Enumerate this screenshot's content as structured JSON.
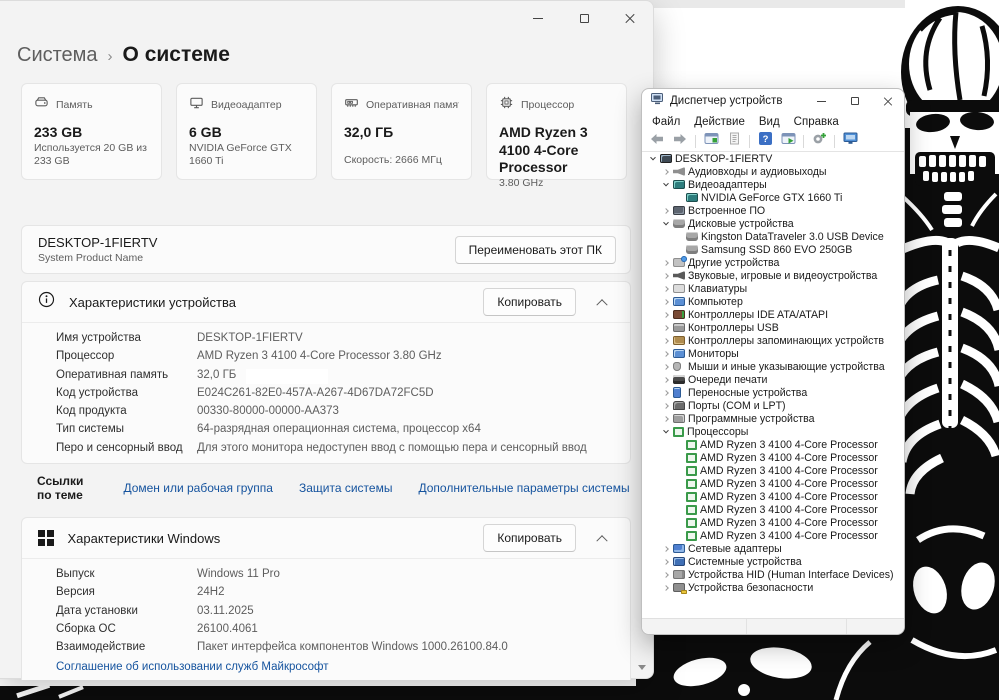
{
  "colors": {
    "link": "#15539e",
    "window_bg": "#f3f3f3",
    "card_bg": "#fbfbfb",
    "cpu_icon_green": "#3a9a4a",
    "help_blue": "#3b6fc4",
    "art_black": "#0c0c0c"
  },
  "settings_window": {
    "window_controls": [
      "minimize",
      "maximize",
      "close"
    ],
    "breadcrumb": {
      "parent": "Система",
      "separator": "›",
      "current": "О системе"
    },
    "cards": [
      {
        "icon": "storage-icon",
        "label": "Память",
        "value": "233 GB",
        "sub": "Используется 20 GB из 233 GB"
      },
      {
        "icon": "gpu-icon",
        "label": "Видеоадаптер",
        "value": "6 GB",
        "sub": "NVIDIA GeForce GTX 1660 Ti"
      },
      {
        "icon": "ram-icon",
        "label": "Оперативная память",
        "value": "32,0 ГБ",
        "sub": "Скорость: 2666 МГц"
      },
      {
        "icon": "cpu-icon",
        "label": "Процессор",
        "value": "AMD Ryzen 3 4100 4-Core Processor",
        "sub": "3.80 GHz"
      }
    ],
    "device_name": {
      "name": "DESKTOP-1FIERTV",
      "sub": "System Product Name",
      "rename_button": "Переименовать этот ПК"
    },
    "device_specs": {
      "icon": "info-icon",
      "title": "Характеристики устройства",
      "copy_button": "Копировать",
      "rows": [
        {
          "label": "Имя устройства",
          "value": "DESKTOP-1FIERTV"
        },
        {
          "label": "Процессор",
          "value": "AMD Ryzen 3 4100 4-Core Processor",
          "value2": "3.80 GHz"
        },
        {
          "label": "Оперативная память",
          "value": "32,0 ГБ",
          "redacted": true
        },
        {
          "label": "Код устройства",
          "value": "E024C261-82E0-457A-A267-4D67DA72FC5D"
        },
        {
          "label": "Код продукта",
          "value": "00330-80000-00000-AA373"
        },
        {
          "label": "Тип системы",
          "value": "64-разрядная операционная система, процессор x64"
        },
        {
          "label": "Перо и сенсорный ввод",
          "value": "Для этого монитора недоступен ввод с помощью пера и сенсорный ввод"
        }
      ]
    },
    "related_links": {
      "label": "Ссылки по теме",
      "links": [
        "Домен или рабочая группа",
        "Защита системы",
        "Дополнительные параметры системы"
      ]
    },
    "windows_specs": {
      "icon": "windows-logo-icon",
      "title": "Характеристики Windows",
      "copy_button": "Копировать",
      "rows": [
        {
          "label": "Выпуск",
          "value": "Windows 11 Pro"
        },
        {
          "label": "Версия",
          "value": "24H2"
        },
        {
          "label": "Дата установки",
          "value": "03.11.2025"
        },
        {
          "label": "Сборка ОС",
          "value": "26100.4061"
        },
        {
          "label": "Взаимодействие",
          "value": "Пакет интерфейса компонентов Windows 1000.26100.84.0"
        }
      ],
      "agreement_link": "Соглашение об использовании служб Майкрософт"
    }
  },
  "device_manager": {
    "title": "Диспетчер устройств",
    "window_controls": [
      "minimize",
      "maximize",
      "close"
    ],
    "menu": [
      "Файл",
      "Действие",
      "Вид",
      "Справка"
    ],
    "toolbar": [
      "back-icon",
      "forward-icon",
      "separator",
      "console-tree-icon",
      "export-list-icon",
      "separator",
      "help-icon",
      "action-pane-icon",
      "separator",
      "scan-hardware-icon",
      "separator",
      "device-monitor-icon"
    ],
    "tree": [
      {
        "label": "DESKTOP-1FIERTV",
        "level": 0,
        "expand": "expanded",
        "icon": "computer"
      },
      {
        "label": "Аудиовходы и аудиовыходы",
        "level": 1,
        "expand": "collapsed",
        "icon": "audio"
      },
      {
        "label": "Видеоадаптеры",
        "level": 1,
        "expand": "expanded",
        "icon": "display"
      },
      {
        "label": "NVIDIA GeForce GTX 1660 Ti",
        "level": 2,
        "expand": "none",
        "icon": "display"
      },
      {
        "label": "Встроенное ПО",
        "level": 1,
        "expand": "collapsed",
        "icon": "firmware"
      },
      {
        "label": "Дисковые устройства",
        "level": 1,
        "expand": "expanded",
        "icon": "disk"
      },
      {
        "label": "Kingston DataTraveler 3.0 USB Device",
        "level": 2,
        "expand": "none",
        "icon": "disk"
      },
      {
        "label": "Samsung SSD 860 EVO 250GB",
        "level": 2,
        "expand": "none",
        "icon": "disk"
      },
      {
        "label": "Другие устройства",
        "level": 1,
        "expand": "collapsed",
        "icon": "unknown"
      },
      {
        "label": "Звуковые, игровые и видеоустройства",
        "level": 1,
        "expand": "collapsed",
        "icon": "sound"
      },
      {
        "label": "Клавиатуры",
        "level": 1,
        "expand": "collapsed",
        "icon": "keyboard"
      },
      {
        "label": "Компьютер",
        "level": 1,
        "expand": "collapsed",
        "icon": "computer-cat"
      },
      {
        "label": "Контроллеры IDE ATA/ATAPI",
        "level": 1,
        "expand": "collapsed",
        "icon": "ide"
      },
      {
        "label": "Контроллеры USB",
        "level": 1,
        "expand": "collapsed",
        "icon": "usb"
      },
      {
        "label": "Контроллеры запоминающих устройств",
        "level": 1,
        "expand": "collapsed",
        "icon": "storage-ctl"
      },
      {
        "label": "Мониторы",
        "level": 1,
        "expand": "collapsed",
        "icon": "monitor"
      },
      {
        "label": "Мыши и иные указывающие устройства",
        "level": 1,
        "expand": "collapsed",
        "icon": "mouse"
      },
      {
        "label": "Очереди печати",
        "level": 1,
        "expand": "collapsed",
        "icon": "printer"
      },
      {
        "label": "Переносные устройства",
        "level": 1,
        "expand": "collapsed",
        "icon": "portable"
      },
      {
        "label": "Порты (COM и LPT)",
        "level": 1,
        "expand": "collapsed",
        "icon": "ports"
      },
      {
        "label": "Программные устройства",
        "level": 1,
        "expand": "collapsed",
        "icon": "software"
      },
      {
        "label": "Процессоры",
        "level": 1,
        "expand": "expanded",
        "icon": "cpu"
      },
      {
        "label": "AMD Ryzen 3 4100 4-Core Processor",
        "level": 2,
        "expand": "none",
        "icon": "cpu"
      },
      {
        "label": "AMD Ryzen 3 4100 4-Core Processor",
        "level": 2,
        "expand": "none",
        "icon": "cpu"
      },
      {
        "label": "AMD Ryzen 3 4100 4-Core Processor",
        "level": 2,
        "expand": "none",
        "icon": "cpu"
      },
      {
        "label": "AMD Ryzen 3 4100 4-Core Processor",
        "level": 2,
        "expand": "none",
        "icon": "cpu"
      },
      {
        "label": "AMD Ryzen 3 4100 4-Core Processor",
        "level": 2,
        "expand": "none",
        "icon": "cpu"
      },
      {
        "label": "AMD Ryzen 3 4100 4-Core Processor",
        "level": 2,
        "expand": "none",
        "icon": "cpu"
      },
      {
        "label": "AMD Ryzen 3 4100 4-Core Processor",
        "level": 2,
        "expand": "none",
        "icon": "cpu"
      },
      {
        "label": "AMD Ryzen 3 4100 4-Core Processor",
        "level": 2,
        "expand": "none",
        "icon": "cpu"
      },
      {
        "label": "Сетевые адаптеры",
        "level": 1,
        "expand": "collapsed",
        "icon": "network"
      },
      {
        "label": "Системные устройства",
        "level": 1,
        "expand": "collapsed",
        "icon": "system"
      },
      {
        "label": "Устройства HID (Human Interface Devices)",
        "level": 1,
        "expand": "collapsed",
        "icon": "hid"
      },
      {
        "label": "Устройства безопасности",
        "level": 1,
        "expand": "collapsed",
        "icon": "security"
      }
    ]
  }
}
